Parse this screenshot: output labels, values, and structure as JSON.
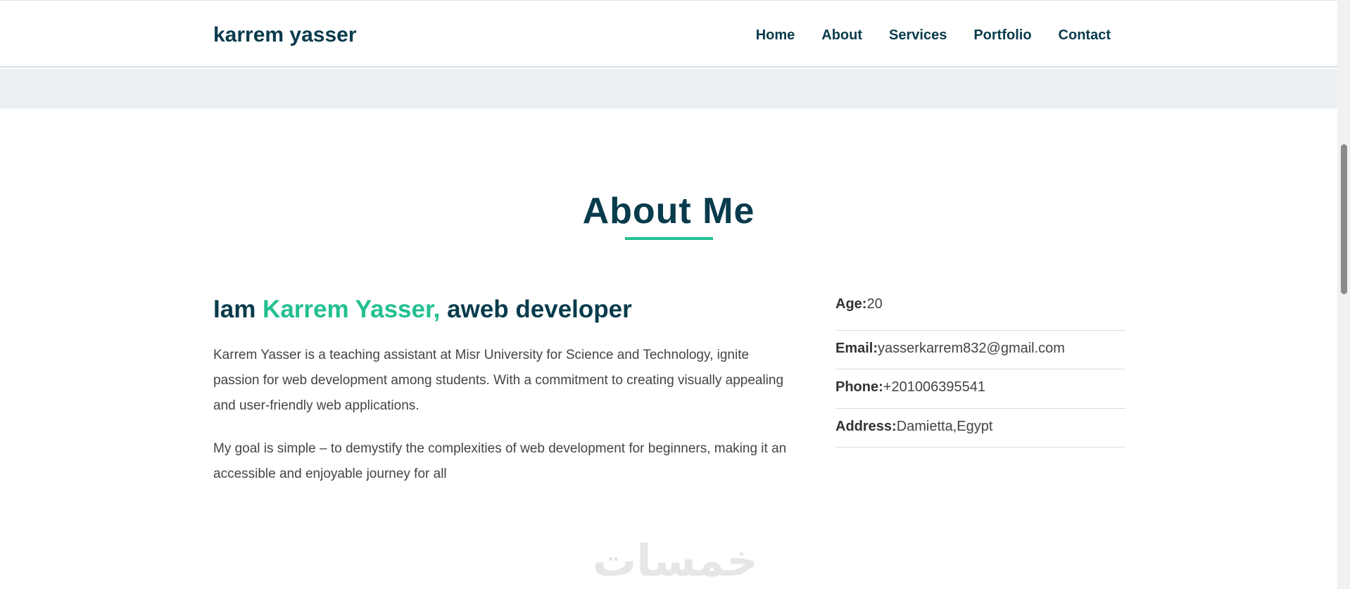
{
  "navbar": {
    "brand": "karrem yasser",
    "links": [
      "Home",
      "About",
      "Services",
      "Portfolio",
      "Contact"
    ]
  },
  "about": {
    "title": "About Me",
    "intro": {
      "prefix": "Iam ",
      "name": "Karrem Yasser,",
      "suffix": " aweb developer"
    },
    "paragraph1": "Karrem Yasser is a teaching assistant at Misr University for Science and Technology, ignite passion for web development among students. With a commitment to creating visually appealing and user-friendly web applications.",
    "paragraph2": "My goal is simple – to demystify the complexities of web development for beginners, making it an accessible and enjoyable journey for all",
    "info": [
      {
        "label": "Age:",
        "value": "20"
      },
      {
        "label": "Email:",
        "value": "yasserkarrem832@gmail.com"
      },
      {
        "label": "Phone:",
        "value": "+201006395541"
      },
      {
        "label": "Address:",
        "value": "Damietta,Egypt"
      }
    ]
  },
  "watermark": "خمسات",
  "colors": {
    "primary": "#083b4c",
    "accent": "#23bf91",
    "band": "#ebeff2"
  }
}
